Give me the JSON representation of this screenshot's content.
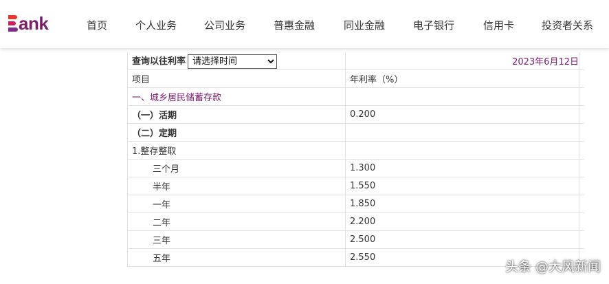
{
  "header": {
    "logo_text": "ank",
    "nav": [
      "首页",
      "个人业务",
      "公司业务",
      "普惠金融",
      "同业金融",
      "电子银行",
      "信用卡",
      "投资者关系"
    ]
  },
  "rates": {
    "query_label": "查询以往利率",
    "select_value": "请选择时间",
    "date": "2023年6月12日",
    "col_item": "项目",
    "col_rate": "年利率（%）",
    "section1": "一、城乡居民储蓄存款",
    "demand_label": "（一）活期",
    "demand_rate": "0.200",
    "fixed_label": "（二）定期",
    "subsection1": "1.整存整取",
    "terms": [
      {
        "label": "三个月",
        "rate": "1.300"
      },
      {
        "label": "半年",
        "rate": "1.550"
      },
      {
        "label": "一年",
        "rate": "1.850"
      },
      {
        "label": "二年",
        "rate": "2.200"
      },
      {
        "label": "三年",
        "rate": "2.500"
      },
      {
        "label": "五年",
        "rate": "2.550"
      }
    ]
  },
  "watermark": "头条 @大风新闻",
  "colors": {
    "brand_purple": "#7a1b6e",
    "logo_red": "#e8382f",
    "logo_pink": "#d11d5c"
  },
  "icons": {
    "logo": "bank-logo-icon"
  }
}
